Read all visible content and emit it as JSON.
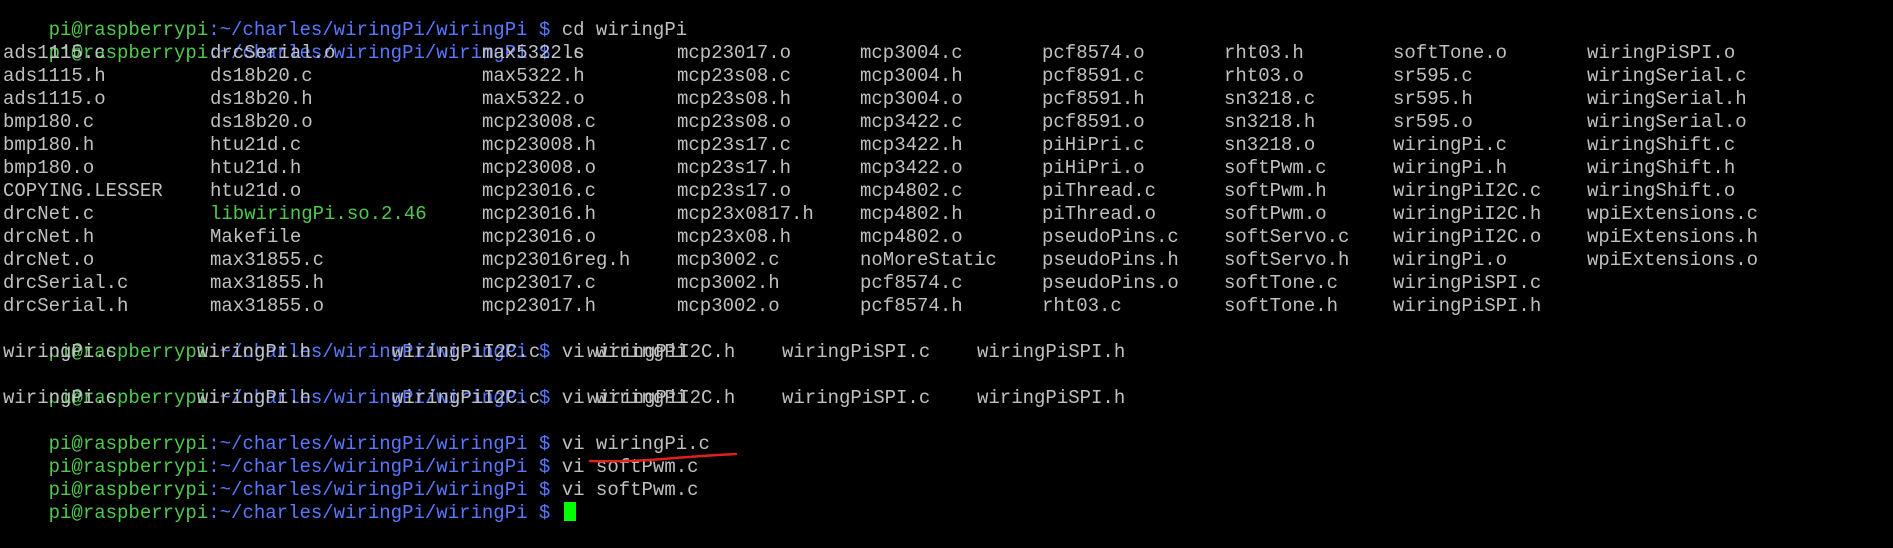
{
  "prompt": {
    "user": "pi@raspberrypi",
    "path": ":~/charles/wiringPi/wiringPi $"
  },
  "lines": [
    {
      "type": "prompt",
      "cmd": " cd wiringPi"
    },
    {
      "type": "prompt",
      "cmd": " ls"
    },
    {
      "type": "prompt",
      "cmd": " vi wiringPi"
    },
    {
      "type": "prompt",
      "cmd": " vi wiringPi"
    },
    {
      "type": "prompt",
      "cmd": " vi wiringPi.c"
    },
    {
      "type": "prompt",
      "cmd": " vi softPwm.c"
    },
    {
      "type": "prompt",
      "cmd": " vi softPwm.c"
    },
    {
      "type": "prompt",
      "cmd": " "
    }
  ],
  "ls_output": [
    [
      "ads1115.c",
      "drcSerial.o",
      "max5322.c",
      "mcp23017.o",
      "mcp3004.c",
      "pcf8574.o",
      "rht03.h",
      "softTone.o",
      "wiringPiSPI.o"
    ],
    [
      "ads1115.h",
      "ds18b20.c",
      "max5322.h",
      "mcp23s08.c",
      "mcp3004.h",
      "pcf8591.c",
      "rht03.o",
      "sr595.c",
      "wiringSerial.c"
    ],
    [
      "ads1115.o",
      "ds18b20.h",
      "max5322.o",
      "mcp23s08.h",
      "mcp3004.o",
      "pcf8591.h",
      "sn3218.c",
      "sr595.h",
      "wiringSerial.h"
    ],
    [
      "bmp180.c",
      "ds18b20.o",
      "mcp23008.c",
      "mcp23s08.o",
      "mcp3422.c",
      "pcf8591.o",
      "sn3218.h",
      "sr595.o",
      "wiringSerial.o"
    ],
    [
      "bmp180.h",
      "htu21d.c",
      "mcp23008.h",
      "mcp23s17.c",
      "mcp3422.h",
      "piHiPri.c",
      "sn3218.o",
      "wiringPi.c",
      "wiringShift.c"
    ],
    [
      "bmp180.o",
      "htu21d.h",
      "mcp23008.o",
      "mcp23s17.h",
      "mcp3422.o",
      "piHiPri.o",
      "softPwm.c",
      "wiringPi.h",
      "wiringShift.h"
    ],
    [
      "COPYING.LESSER",
      "htu21d.o",
      "mcp23016.c",
      "mcp23s17.o",
      "mcp4802.c",
      "piThread.c",
      "softPwm.h",
      "wiringPiI2C.c",
      "wiringShift.o"
    ],
    [
      "drcNet.c",
      "libwiringPi.so.2.46",
      "mcp23016.h",
      "mcp23x0817.h",
      "mcp4802.h",
      "piThread.o",
      "softPwm.o",
      "wiringPiI2C.h",
      "wpiExtensions.c"
    ],
    [
      "drcNet.h",
      "Makefile",
      "mcp23016.o",
      "mcp23x08.h",
      "mcp4802.o",
      "pseudoPins.c",
      "softServo.c",
      "wiringPiI2C.o",
      "wpiExtensions.h"
    ],
    [
      "drcNet.o",
      "max31855.c",
      "mcp23016reg.h",
      "mcp3002.c",
      "noMoreStatic",
      "pseudoPins.h",
      "softServo.h",
      "wiringPi.o",
      "wpiExtensions.o"
    ],
    [
      "drcSerial.c",
      "max31855.h",
      "mcp23017.c",
      "mcp3002.h",
      "pcf8574.c",
      "pseudoPins.o",
      "softTone.c",
      "wiringPiSPI.c",
      ""
    ],
    [
      "drcSerial.h",
      "max31855.o",
      "mcp23017.h",
      "mcp3002.o",
      "pcf8574.h",
      "rht03.c",
      "softTone.h",
      "wiringPiSPI.h",
      ""
    ]
  ],
  "completion_output": [
    "wiringPi.c",
    "wiringPi.h",
    "wiringPiI2C.c",
    "wiringPiI2C.h",
    "wiringPiSPI.c",
    "wiringPiSPI.h"
  ],
  "colors": {
    "background": "#000000",
    "text": "#c0c0c0",
    "user": "#4ec94e",
    "path": "#5a78ff",
    "executable": "#4ec94e",
    "cursor": "#00ff00",
    "annotation": "#e0201c"
  }
}
